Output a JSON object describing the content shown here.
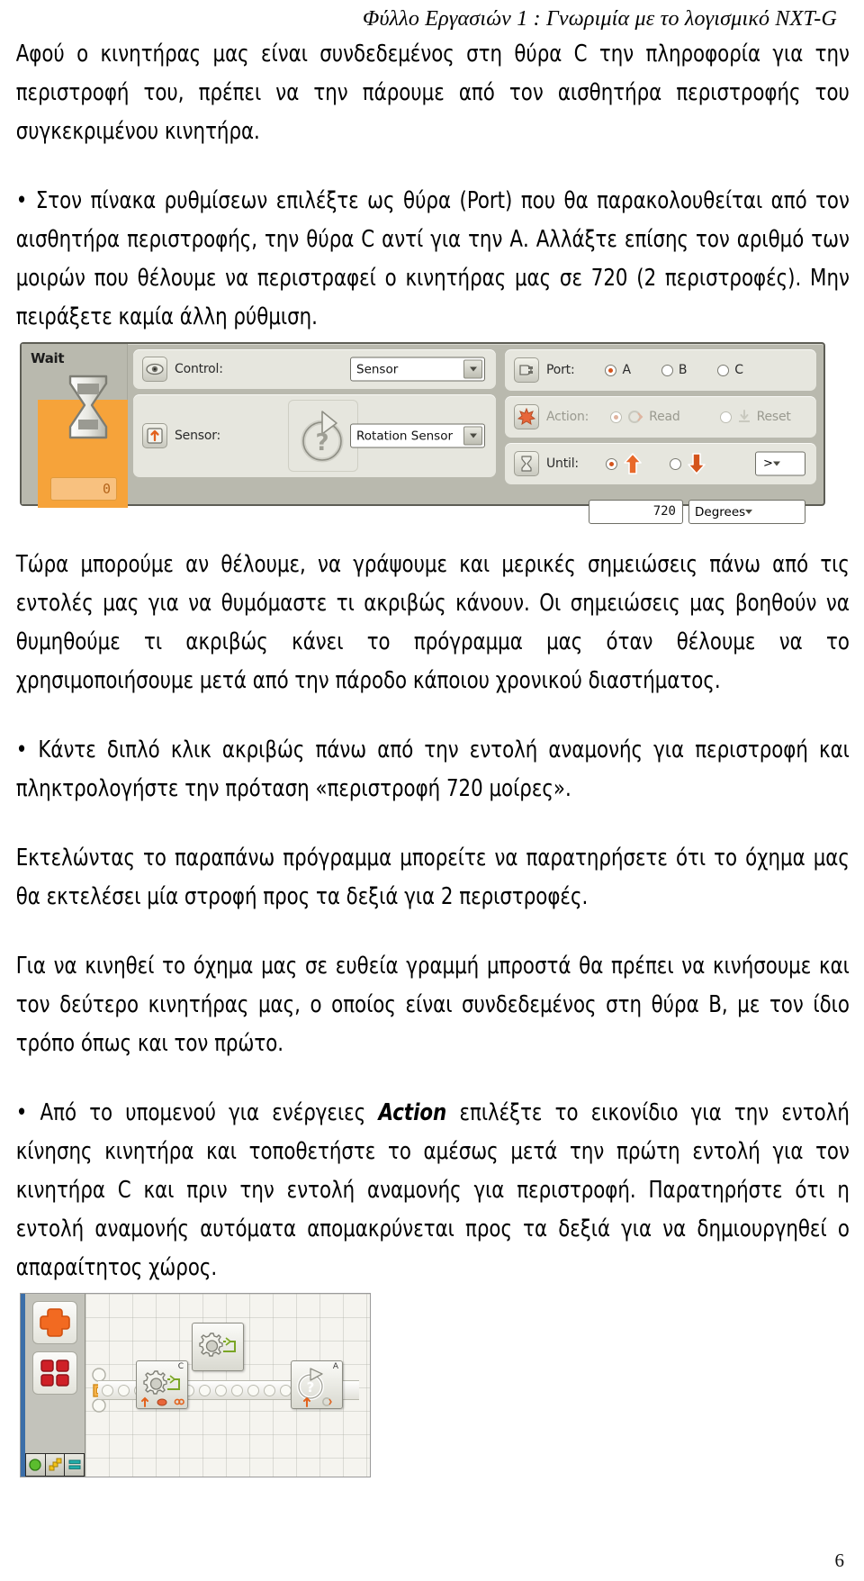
{
  "header": {
    "title": "Φύλλο Εργασιών 1 : Γνωριμία  με το λογισμικό NXT-G"
  },
  "paragraphs": {
    "p1": "Αφού ο κινητήρας μας είναι συνδεδεμένος στη θύρα C την πληροφορία για την περιστροφή του, πρέπει να την πάρουμε από τον αισθητήρα περιστροφής του συγκεκριμένου κινητήρα.",
    "p2": "• Στον πίνακα ρυθμίσεων επιλέξτε ως θύρα (Port) που θα παρακολουθείται από τον αισθητήρα περιστροφής, την θύρα C αντί για την Α. Αλλάξτε επίσης τον αριθμό των μοιρών που θέλουμε να περιστραφεί ο κινητήρας μας σε 720 (2 περιστροφές). Μην πειράξετε καμία άλλη ρύθμιση.",
    "p3": "Τώρα μπορούμε αν θέλουμε, να γράψουμε και μερικές σημειώσεις πάνω από τις εντολές μας για να θυμόμαστε τι ακριβώς κάνουν. Οι σημειώσεις μας βοηθούν να θυμηθούμε τι ακριβώς κάνει το πρόγραμμα μας όταν θέλουμε να το χρησιμοποιήσουμε μετά από την πάροδο κάποιου χρονικού διαστήματος.",
    "p4": "• Κάντε διπλό κλικ ακριβώς πάνω από την εντολή αναμονής για περιστροφή και πληκτρολογήστε την πρόταση «περιστροφή 720 μοίρες».",
    "p5": "Εκτελώντας το παραπάνω πρόγραμμα μπορείτε να παρατηρήσετε ότι το όχημα μας θα εκτελέσει μία στροφή προς τα δεξιά για 2 περιστροφές.",
    "p6": "Για να κινηθεί το όχημα μας σε ευθεία γραμμή μπροστά θα πρέπει να κινήσουμε και τον δεύτερο κινητήρας μας, ο οποίος είναι συνδεδεμένος στη θύρα Β, με τον ίδιο τρόπο όπως και τον πρώτο.",
    "p7_a": "• Από το υπομενού για ενέργειες ",
    "p7_b": "Action",
    "p7_c": " επιλέξτε το εικονίδιο για την εντολή κίνησης κινητήρα και τοποθετήστε το αμέσως μετά την πρώτη εντολή για τον κινητήρα C και πριν την εντολή αναμονής για περιστροφή. Παρατηρήστε ότι η εντολή αναμονής αυτόματα απομακρύνεται προς τα δεξιά για να δημιουργηθεί ο απαραίτητος χώρος."
  },
  "config_panel": {
    "block_title": "Wait",
    "block_value": "0",
    "control_label": "Control:",
    "control_value": "Sensor",
    "sensor_label": "Sensor:",
    "sensor_value": "Rotation Sensor",
    "port_label": "Port:",
    "port_options": [
      "A",
      "B",
      "C"
    ],
    "port_selected": "A",
    "action_label": "Action:",
    "action_options": [
      "Read",
      "Reset"
    ],
    "action_selected": "Read",
    "until_label": "Until:",
    "until_direction": "up",
    "comparator": ">",
    "degrees_value": "720",
    "degrees_unit": "Degrees"
  },
  "program_canvas": {
    "move_block_port": "C",
    "wait_block_port": "A",
    "floating_block_port": ""
  },
  "footer": {
    "page_number": "6"
  }
}
